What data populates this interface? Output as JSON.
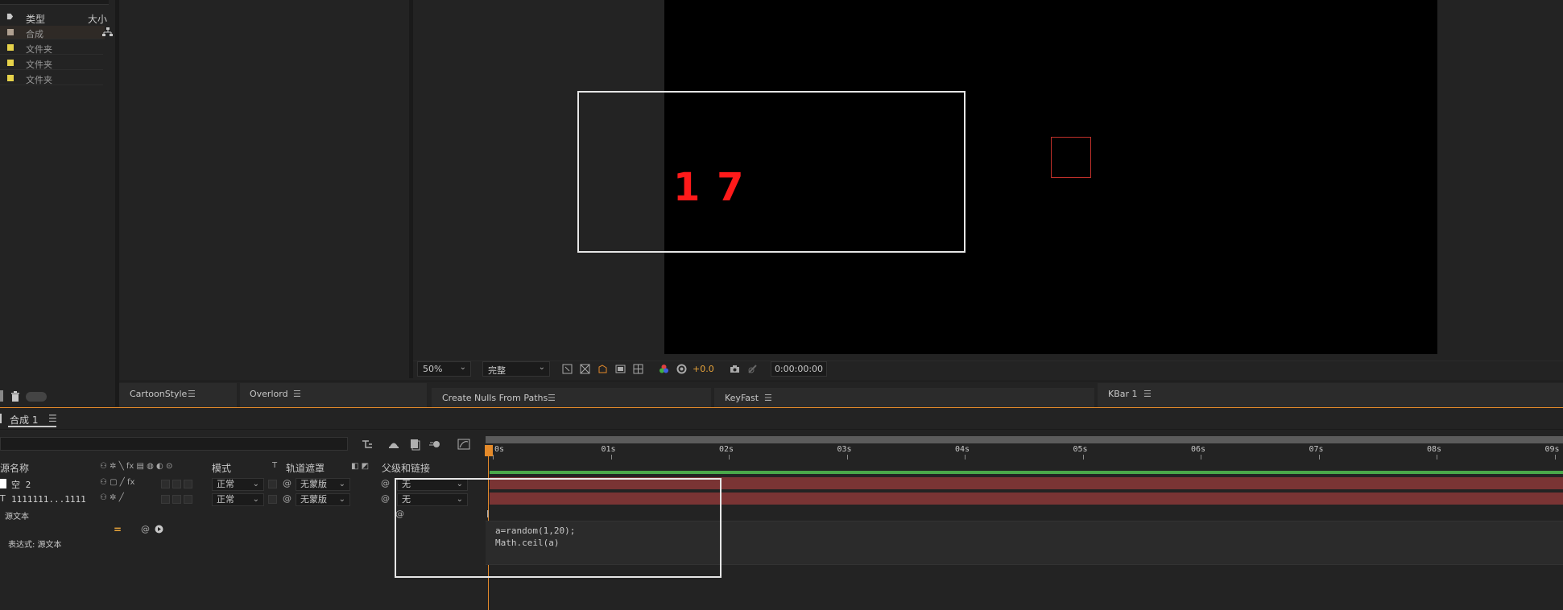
{
  "project": {
    "col_type": "类型",
    "col_size": "大小",
    "items": [
      {
        "type": "合成",
        "color": "#b0a090"
      },
      {
        "type": "文件夹",
        "color": "#e6d24a"
      },
      {
        "type": "文件夹",
        "color": "#e6d24a"
      },
      {
        "type": "文件夹",
        "color": "#e6d24a"
      }
    ]
  },
  "viewer": {
    "canvas_text": "1 7",
    "zoom": "50%",
    "resolution": "完整",
    "exposure": "+0.0",
    "timecode": "0:00:00:00"
  },
  "plugins": [
    {
      "label": "CartoonStyle"
    },
    {
      "label": "Overlord"
    },
    {
      "label": "Create Nulls From Paths"
    },
    {
      "label": "KeyFast"
    },
    {
      "label": "KBar 1"
    }
  ],
  "timeline": {
    "comp_tab": "合成 1",
    "columns": {
      "source_name": "源名称",
      "mode": "模式",
      "t": "T",
      "track_matte": "轨道遮罩",
      "parent": "父级和链接"
    },
    "ticks": [
      "0s",
      "01s",
      "02s",
      "03s",
      "04s",
      "05s",
      "06s",
      "07s",
      "08s",
      "09s"
    ],
    "layers": [
      {
        "name": "空 2",
        "mode": "正常",
        "matte": "无蒙版",
        "parent": "无"
      },
      {
        "name": "1111111...1111",
        "mode": "正常",
        "matte": "无蒙版",
        "parent": "无"
      }
    ],
    "property_label": "源文本",
    "expression_label": "表达式: 源文本",
    "expression_code": "a=random(1,20);\nMath.ceil(a)",
    "equals_sign": "="
  },
  "colors": {
    "accent": "#e48a2a",
    "work_area": "#4aa84a",
    "layer_bar": "#7a3434",
    "canvas_text": "#ff1a1a"
  }
}
